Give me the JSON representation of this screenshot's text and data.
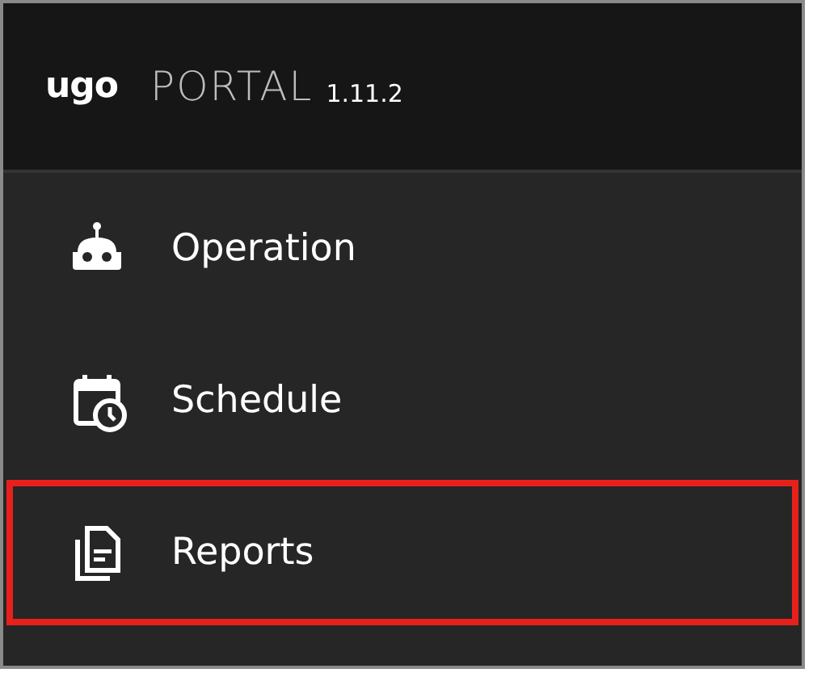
{
  "header": {
    "logo": "ugo",
    "product": "PORTAL",
    "version": "1.11.2"
  },
  "menu": [
    {
      "label": "Operation",
      "highlighted": false
    },
    {
      "label": "Schedule",
      "highlighted": false
    },
    {
      "label": "Reports",
      "highlighted": true
    }
  ]
}
